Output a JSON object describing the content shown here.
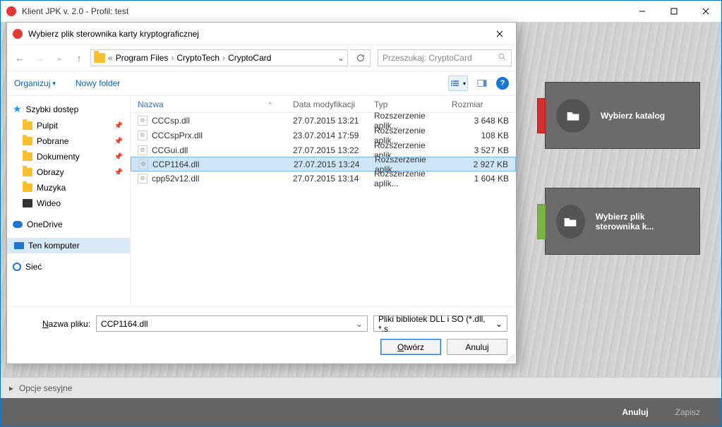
{
  "app": {
    "title": "Klient JPK v. 2.0 - Profil: test"
  },
  "right": {
    "panel1": "Wybierz katalog",
    "panel2": "Wybierz plik sterownika k..."
  },
  "session": {
    "label": "Opcje sesyjne"
  },
  "footer": {
    "cancel": "Anuluj",
    "save": "Zapisz"
  },
  "dialog": {
    "title": "Wybierz plik sterownika karty kryptograficznej",
    "breadcrumb": {
      "seg1": "Program Files",
      "seg2": "CryptoTech",
      "seg3": "CryptoCard"
    },
    "search_placeholder": "Przeszukaj: CryptoCard",
    "toolbar": {
      "organize": "Organizuj",
      "new_folder": "Nowy folder"
    },
    "columns": {
      "name": "Nazwa",
      "date": "Data modyfikacji",
      "type": "Typ",
      "size": "Rozmiar"
    },
    "quick_access": "Szybki dostęp",
    "sidebar": {
      "pulpit": "Pulpit",
      "pobrane": "Pobrane",
      "dokumenty": "Dokumenty",
      "obrazy": "Obrazy",
      "muzyka": "Muzyka",
      "wideo": "Wideo",
      "onedrive": "OneDrive",
      "thispc": "Ten komputer",
      "network": "Sieć"
    },
    "files": [
      {
        "name": "CCCsp.dll",
        "date": "27.07.2015 13:21",
        "type": "Rozszerzenie aplik...",
        "size": "3 648 KB"
      },
      {
        "name": "CCCspPrx.dll",
        "date": "23.07.2014 17:59",
        "type": "Rozszerzenie aplik...",
        "size": "108 KB"
      },
      {
        "name": "CCGui.dll",
        "date": "27.07.2015 13:22",
        "type": "Rozszerzenie aplik...",
        "size": "3 527 KB"
      },
      {
        "name": "CCP1164.dll",
        "date": "27.07.2015 13:24",
        "type": "Rozszerzenie aplik...",
        "size": "2 927 KB"
      },
      {
        "name": "cpp52v12.dll",
        "date": "27.07.2015 13:14",
        "type": "Rozszerzenie aplik...",
        "size": "1 604 KB"
      }
    ],
    "filename_label_pre": "N",
    "filename_label_post": "azwa pliku:",
    "filename_value": "CCP1164.dll",
    "filter": "Pliki bibliotek DLL i SO (*.dll, *.s",
    "open_pre": "O",
    "open_post": "twórz",
    "cancel": "Anuluj"
  }
}
